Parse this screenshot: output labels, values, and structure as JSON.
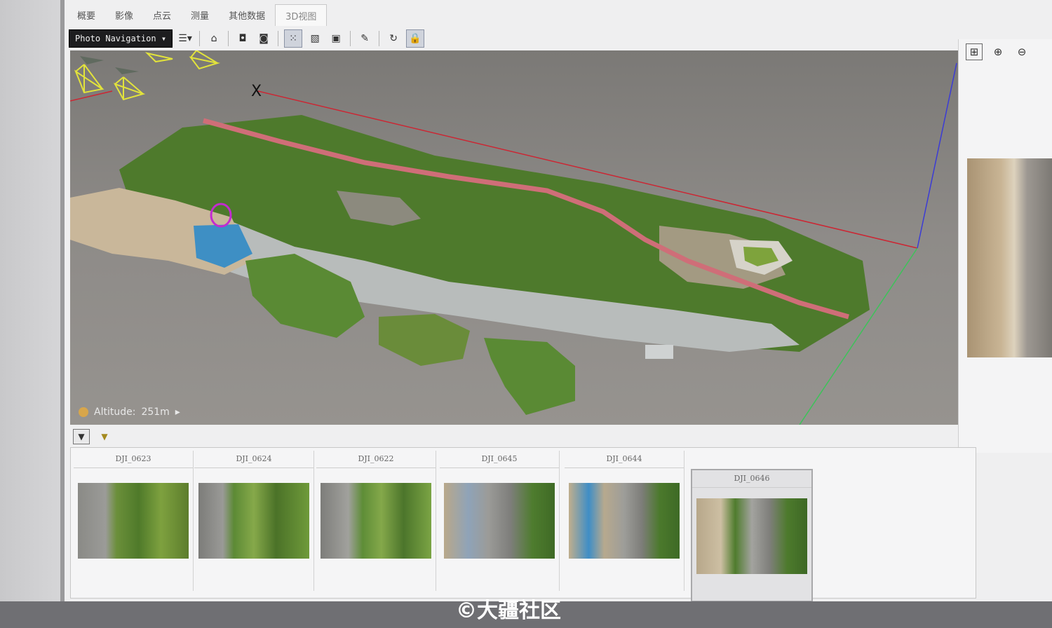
{
  "tabs": [
    "概要",
    "影像",
    "点云",
    "测量",
    "其他数据",
    "3D视图"
  ],
  "toolbar": {
    "nav_mode": "Photo Navigation"
  },
  "viewport": {
    "altitude_label": "Altitude:",
    "altitude_value": "251m",
    "axis_marker": "X"
  },
  "thumbnails": [
    {
      "name": "DJI_0623"
    },
    {
      "name": "DJI_0624"
    },
    {
      "name": "DJI_0622"
    },
    {
      "name": "DJI_0645"
    },
    {
      "name": "DJI_0644"
    },
    {
      "name": "DJI_0646",
      "selected": true
    }
  ],
  "watermark": "©大疆社区",
  "icons": {
    "toolbar": [
      "layers-icon",
      "home-icon",
      "camera-small-icon",
      "camera-icon",
      "point-grid-icon",
      "mesh-icon",
      "texture-icon",
      "ruler-icon",
      "rotate-icon",
      "lock-icon"
    ],
    "right_panel": [
      "fit-view-icon",
      "zoom-in-icon",
      "zoom-out-icon"
    ],
    "filter": [
      "filter-icon",
      "filter-clear-icon"
    ]
  }
}
